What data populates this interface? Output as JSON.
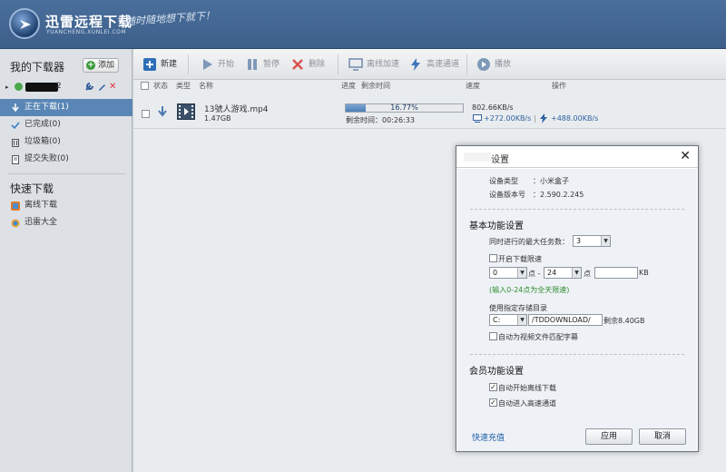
{
  "header": {
    "brand_title": "迅雷远程下载",
    "brand_sub": "YUANCHENG.XUNLEI.COM",
    "slogan": "随时随地想下就下！"
  },
  "sidebar": {
    "heading": "我的下载器",
    "add_label": "添加",
    "device_suffix": "2",
    "nav": [
      {
        "label": "正在下载(1)",
        "icon": "download-arrow-icon",
        "active": true
      },
      {
        "label": "已完成(0)",
        "icon": "check-icon",
        "active": false
      },
      {
        "label": "垃圾箱(0)",
        "icon": "trash-icon",
        "active": false
      },
      {
        "label": "提交失败(0)",
        "icon": "document-icon",
        "active": false
      }
    ],
    "quick_heading": "快速下载",
    "quick": [
      {
        "label": "离线下载",
        "icon": "offline-icon"
      },
      {
        "label": "迅雷大全",
        "icon": "globe-icon"
      }
    ]
  },
  "toolbar": {
    "new": "新建",
    "start": "开始",
    "pause": "暂停",
    "delete": "删除",
    "offline_accel": "离线加速",
    "high_speed": "高速通道",
    "unlimited": "播放"
  },
  "columns": {
    "status": "状态",
    "type": "类型",
    "name": "名称",
    "progress": "进度",
    "remaining": "剩余时间",
    "speed": "速度",
    "action": "操作"
  },
  "task": {
    "name": "13號人游戏.mp4",
    "size": "1.47GB",
    "progress_text": "16.77%",
    "progress_value": 16.77,
    "remaining": "剩余时间：00:26:33",
    "speed": "802.66KB/s",
    "offline_speed": "+272.00KB/s",
    "highspeed_speed": "+488.00KB/s"
  },
  "dialog": {
    "title": "设置",
    "device_type_label": "设备类型",
    "device_type_value": "：小米盒子",
    "version_label": "设备版本号",
    "version_value": "：2.590.2.245",
    "basic_heading": "基本功能设置",
    "max_tasks_label": "同时进行的最大任务数：",
    "max_tasks_value": "3",
    "speed_limit_label": "开启下载限速",
    "from_hour": "0",
    "hour_unit_1": "点 -",
    "to_hour": "24",
    "hour_unit_2": "点",
    "kb_unit": "KB",
    "limit_hint": "(输入0-24点为全天限速)",
    "storage_label": "使用指定存储目录",
    "drive_value": "C:",
    "path_value": "/TDDOWNLOAD/",
    "free_space": "剩余8.40GB",
    "subtitle_label": "自动为视频文件匹配字幕",
    "member_heading": "会员功能设置",
    "auto_offline_label": "自动开始离线下载",
    "auto_highspeed_label": "自动进入高速通道",
    "recharge_link": "快速充值",
    "apply_button": "应用",
    "cancel_button": "取消"
  }
}
